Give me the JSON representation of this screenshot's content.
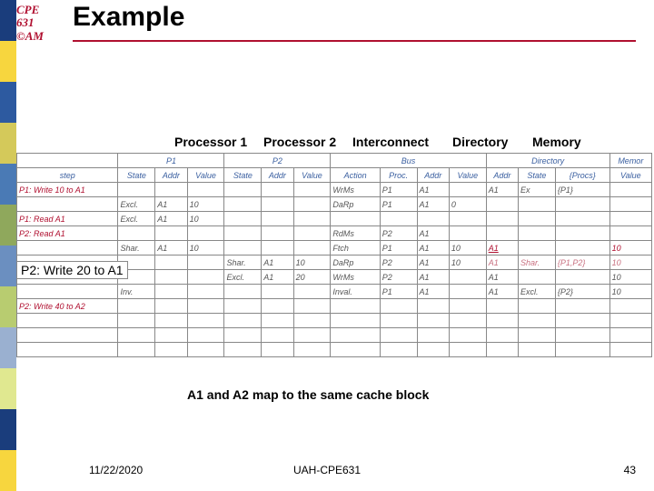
{
  "logo": {
    "line1": "CPE",
    "line2": "631",
    "line3": "©AM"
  },
  "title": "Example",
  "col_labels": {
    "p1": "Processor 1",
    "p2": "Processor 2",
    "ic": "Interconnect",
    "dir": "Directory",
    "mem": "Memory"
  },
  "head": {
    "step": "step",
    "p1": "P1",
    "p2": "P2",
    "state": "State",
    "addr": "Addr",
    "value": "Value",
    "bus": "Bus",
    "action": "Action",
    "proc": "Proc.",
    "dir": "Directory",
    "procs": "{Procs}",
    "mem": "Memor"
  },
  "rows": [
    {
      "step": "P1: Write 10 to A1",
      "bact": "WrMs",
      "bproc": "P1",
      "baddr": "A1",
      "daddr": "A1",
      "dstate": "Ex",
      "dprocs": "{P1}"
    },
    {
      "p1s": "Excl.",
      "p1a": "A1",
      "p1v": "10",
      "bact": "DaRp",
      "bproc": "P1",
      "baddr": "A1",
      "bval": "0"
    },
    {
      "step": "P1: Read A1",
      "p1s": "Excl.",
      "p1a": "A1",
      "p1v": "10"
    },
    {
      "step": "P2: Read A1",
      "bact": "RdMs",
      "bproc": "P2",
      "baddr": "A1"
    },
    {
      "p1s": "Shar.",
      "p1a": "A1",
      "p1v": "10",
      "bact": "Ftch",
      "bproc": "P1",
      "baddr": "A1",
      "bval": "10",
      "daddr": "A1",
      "daddr_link": true,
      "mval": "10",
      "mred": true
    },
    {
      "p2s": "Shar.",
      "p2a": "A1",
      "p2v": "10",
      "bact": "DaRp",
      "bproc": "P2",
      "baddr": "A1",
      "bval": "10",
      "daddr": "A1",
      "dstate": "Shar.",
      "dprocs": "{P1,P2}",
      "mval": "10",
      "dimrow": true
    },
    {
      "p2s": "Excl.",
      "p2a": "A1",
      "p2v": "20",
      "bact": "WrMs",
      "bproc": "P2",
      "baddr": "A1",
      "daddr": "A1",
      "mval": "10"
    },
    {
      "p1s": "Inv.",
      "bact": "Inval.",
      "bproc": "P1",
      "baddr": "A1",
      "daddr": "A1",
      "dstate": "Excl.",
      "dprocs": "{P2}",
      "mval": "10"
    },
    {
      "step": "P2: Write 40 to A2"
    },
    {},
    {},
    {}
  ],
  "overlay_step": "P2: Write 20 to A1",
  "note": "A1 and A2 map to the same cache block",
  "footer": {
    "date": "11/22/2020",
    "center": "UAH-CPE631",
    "page": "43"
  },
  "chart_data": {
    "type": "table",
    "columns": [
      "step",
      "P1.State",
      "P1.Addr",
      "P1.Value",
      "P2.State",
      "P2.Addr",
      "P2.Value",
      "Bus.Action",
      "Bus.Proc",
      "Bus.Addr",
      "Bus.Value",
      "Dir.Addr",
      "Dir.State",
      "Dir.{Procs}",
      "Mem.Value"
    ],
    "rows": [
      [
        "P1: Write 10 to A1",
        "",
        "",
        "",
        "",
        "",
        "",
        "WrMs",
        "P1",
        "A1",
        "",
        "A1",
        "Ex",
        "{P1}",
        ""
      ],
      [
        "",
        "Excl.",
        "A1",
        "10",
        "",
        "",
        "",
        "DaRp",
        "P1",
        "A1",
        "0",
        "",
        "",
        "",
        ""
      ],
      [
        "P1: Read A1",
        "Excl.",
        "A1",
        "10",
        "",
        "",
        "",
        "",
        "",
        "",
        "",
        "",
        "",
        "",
        ""
      ],
      [
        "P2: Read A1",
        "",
        "",
        "",
        "",
        "",
        "",
        "RdMs",
        "P2",
        "A1",
        "",
        "",
        "",
        "",
        ""
      ],
      [
        "",
        "Shar.",
        "A1",
        "10",
        "",
        "",
        "",
        "Ftch",
        "P1",
        "A1",
        "10",
        "A1",
        "",
        "",
        "10"
      ],
      [
        "",
        "",
        "",
        "",
        "Shar.",
        "A1",
        "10",
        "DaRp",
        "P2",
        "A1",
        "10",
        "A1",
        "Shar.",
        "{P1,P2}",
        "10"
      ],
      [
        "P2: Write 20 to A1",
        "",
        "",
        "",
        "Excl.",
        "A1",
        "20",
        "WrMs",
        "P2",
        "A1",
        "",
        "A1",
        "",
        "",
        "10"
      ],
      [
        "",
        "Inv.",
        "",
        "",
        "",
        "",
        "",
        "Inval.",
        "P1",
        "A1",
        "",
        "A1",
        "Excl.",
        "{P2}",
        "10"
      ],
      [
        "P2: Write 40 to A2",
        "",
        "",
        "",
        "",
        "",
        "",
        "",
        "",
        "",
        "",
        "",
        "",
        "",
        ""
      ]
    ]
  }
}
